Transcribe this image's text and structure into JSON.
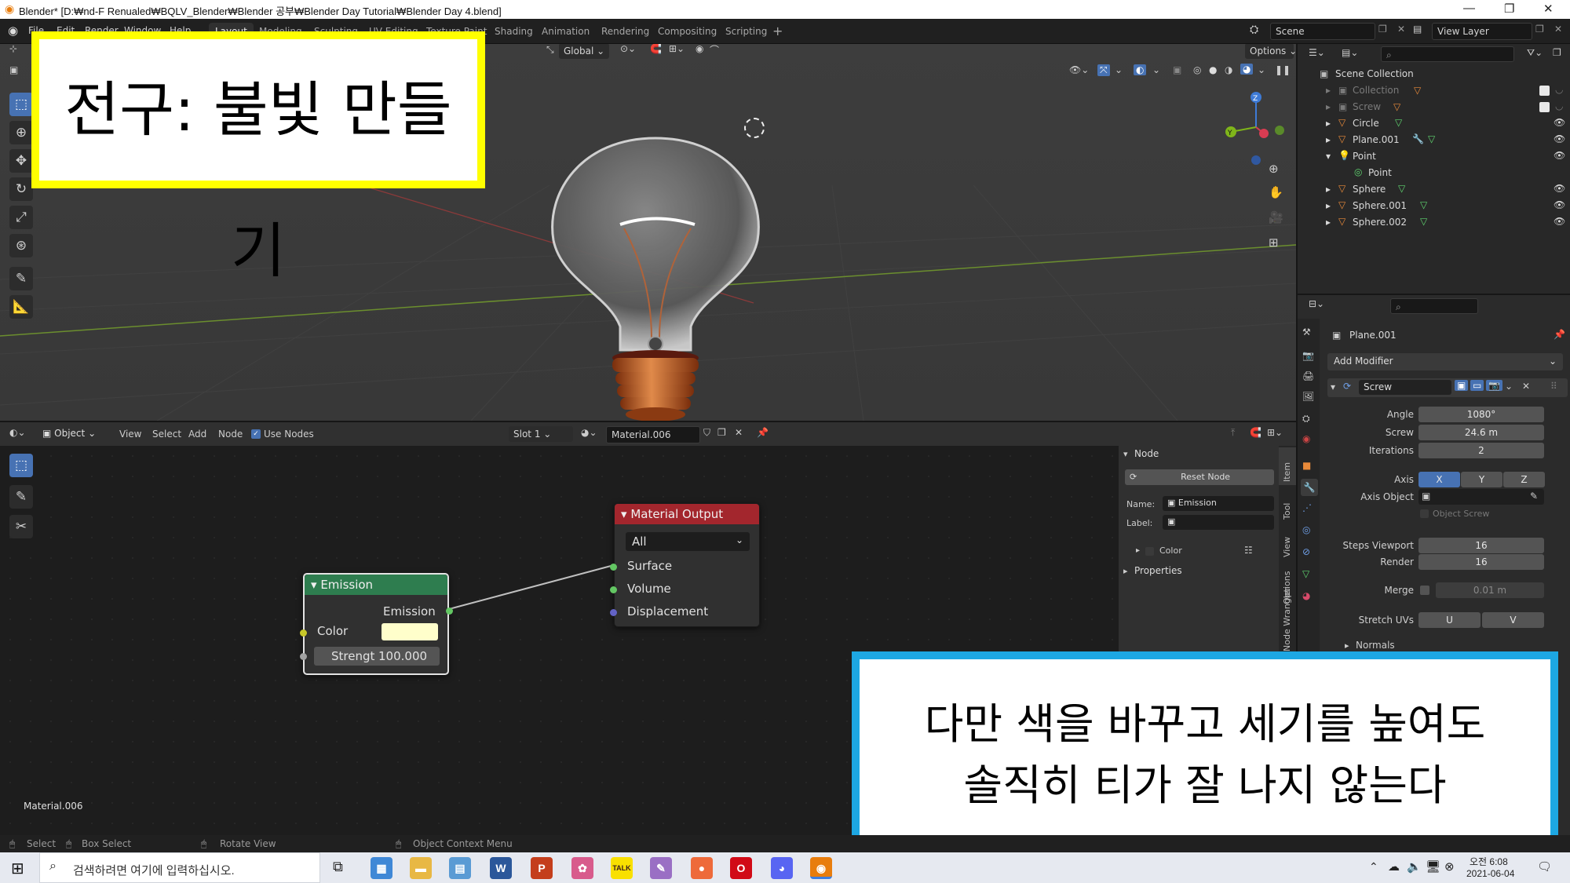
{
  "window": {
    "title": "Blender* [D:₩nd-F Renualed₩BQLV_Blender₩Blender 공부₩Blender Day Tutorial₩Blender Day 4.blend]"
  },
  "menubar": {
    "menus": [
      "File",
      "Edit",
      "Render",
      "Window",
      "Help"
    ],
    "workspaces": [
      "Layout",
      "Modeling",
      "Sculpting",
      "UV Editing",
      "Texture Paint",
      "Shading",
      "Animation",
      "Rendering",
      "Compositing",
      "Scripting"
    ],
    "scene": "Scene",
    "view_layer": "View Layer"
  },
  "viewport": {
    "transform_orientation": "Global",
    "options": "Options",
    "gizmo_axes": [
      "Z",
      "Y",
      "X"
    ]
  },
  "overlays": {
    "top_left": "전구: 불빛 만들기",
    "bottom_right_line1": "다만 색을 바꾸고 세기를 높여도",
    "bottom_right_line2": "솔직히 티가 잘 나지 않는다"
  },
  "outliner": {
    "root": "Scene Collection",
    "items": [
      {
        "name": "Collection",
        "dim": true
      },
      {
        "name": "Screw",
        "dim": true
      },
      {
        "name": "Circle",
        "dim": false
      },
      {
        "name": "Plane.001",
        "dim": false
      },
      {
        "name": "Point",
        "dim": false
      },
      {
        "name": "Point",
        "dim": false
      },
      {
        "name": "Sphere",
        "dim": false
      },
      {
        "name": "Sphere.001",
        "dim": false
      },
      {
        "name": "Sphere.002",
        "dim": false
      }
    ]
  },
  "properties": {
    "object_name": "Plane.001",
    "add_modifier": "Add Modifier",
    "modifier_name": "Screw",
    "angle_label": "Angle",
    "angle_value": "1080°",
    "screw_label": "Screw",
    "screw_value": "24.6 m",
    "iterations_label": "Iterations",
    "iterations_value": "2",
    "axis_label": "Axis",
    "axis_x": "X",
    "axis_y": "Y",
    "axis_z": "Z",
    "axis_object_label": "Axis Object",
    "object_screw_label": "Object Screw",
    "steps_viewport_label": "Steps Viewport",
    "steps_viewport_value": "16",
    "render_label": "Render",
    "render_value": "16",
    "merge_label": "Merge",
    "merge_value": "0.01 m",
    "stretch_uvs_label": "Stretch UVs",
    "stretch_u": "U",
    "stretch_v": "V",
    "normals_label": "Normals"
  },
  "node_header": {
    "mode": "Object",
    "menus": [
      "View",
      "Select",
      "Add",
      "Node"
    ],
    "use_nodes": "Use Nodes",
    "slot": "Slot 1",
    "material": "Material.006"
  },
  "nodes": {
    "emission": {
      "title": "Emission",
      "output": "Emission",
      "color_label": "Color",
      "color_value": "#fffecb",
      "strength_label": "Strengt",
      "strength_value": "100.000"
    },
    "material_output": {
      "title": "Material Output",
      "target": "All",
      "inputs": [
        "Surface",
        "Volume",
        "Displacement"
      ]
    },
    "material_label": "Material.006"
  },
  "n_sidebar": {
    "section": "Node",
    "reset_node": "Reset Node",
    "name_label": "Name:",
    "name_value": "Emission",
    "label_label": "Label:",
    "color_label": "Color",
    "properties_label": "Properties",
    "tabs": [
      "Item",
      "Tool",
      "View",
      "Options",
      "Node Wrangler"
    ]
  },
  "statusbar": {
    "select": "Select",
    "box_select": "Box Select",
    "rotate_view": "Rotate View",
    "context_menu": "Object Context Menu"
  },
  "taskbar": {
    "search_placeholder": "검색하려면 여기에 입력하십시오.",
    "time": "오전 6:08",
    "date": "2021-06-04"
  },
  "colors": {
    "accent": "#4772b3",
    "emission_header": "#2e7d4f",
    "output_header": "#a3262d",
    "socket_green": "#63c763",
    "socket_yellow": "#c7c729",
    "socket_purple": "#6363c7",
    "overlay_yellow_border": "#ffff00",
    "overlay_blue_border": "#1da7e3"
  }
}
